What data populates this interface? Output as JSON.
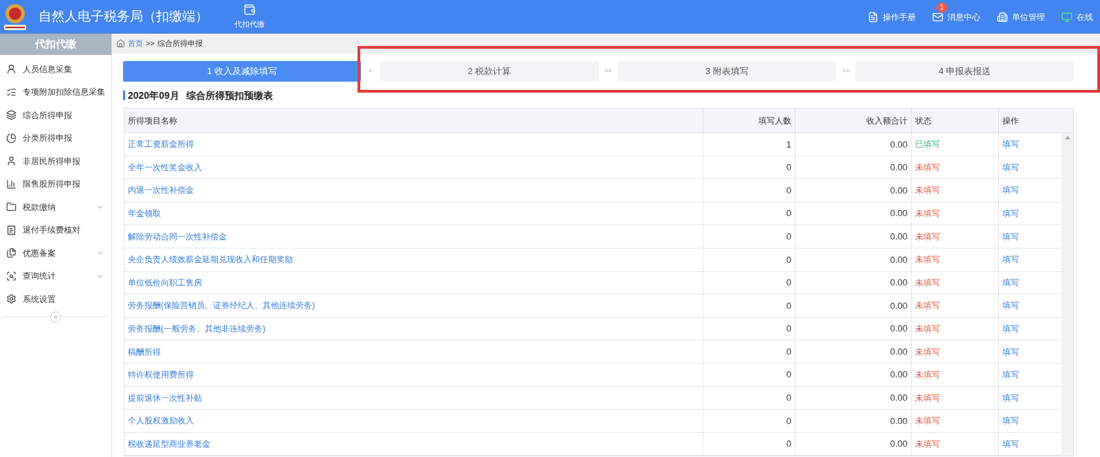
{
  "header": {
    "title": "自然人电子税务局（扣缴端）",
    "module": "代扣代缴",
    "links": [
      {
        "label": "操作手册"
      },
      {
        "label": "消息中心",
        "badge": "1"
      },
      {
        "label": "单位管理"
      },
      {
        "label": "在线"
      }
    ]
  },
  "sidebar": {
    "title": "代扣代缴",
    "items": [
      {
        "label": "人员信息采集",
        "expandable": false
      },
      {
        "label": "专项附加扣除信息采集",
        "expandable": false
      },
      {
        "label": "综合所得申报",
        "expandable": false
      },
      {
        "label": "分类所得申报",
        "expandable": false
      },
      {
        "label": "非居民所得申报",
        "expandable": false
      },
      {
        "label": "限售股所得申报",
        "expandable": false
      },
      {
        "label": "税款缴纳",
        "expandable": true
      },
      {
        "label": "退付手续费核对",
        "expandable": false
      },
      {
        "label": "优惠备案",
        "expandable": true
      },
      {
        "label": "查询统计",
        "expandable": true
      },
      {
        "label": "系统设置",
        "expandable": false
      }
    ],
    "collapse": "«"
  },
  "breadcrumb": {
    "home": "首页",
    "separator": ">>",
    "current": "综合所得申报"
  },
  "steps": [
    {
      "label": "1 收入及减除填写",
      "selected": true
    },
    {
      "separator": ">",
      "label": "2 税款计算",
      "selected": false
    },
    {
      "separator": ">>",
      "label": "3 附表填写",
      "selected": false
    },
    {
      "separator": ">>",
      "label": "4 申报表报送",
      "selected": false
    }
  ],
  "table_title": {
    "period": "2020年09月",
    "name": "综合所得预扣预缴表"
  },
  "table": {
    "columns": [
      "所得项目名称",
      "填写人数",
      "收入额合计",
      "状态",
      "操作"
    ],
    "rows": [
      {
        "name": "正常工资薪金所得",
        "count": "1",
        "amount": "0.00",
        "status": "已填写",
        "filled": true,
        "action": "填写"
      },
      {
        "name": "全年一次性奖金收入",
        "count": "0",
        "amount": "0.00",
        "status": "未填写",
        "filled": false,
        "action": "填写"
      },
      {
        "name": "内退一次性补偿金",
        "count": "0",
        "amount": "0.00",
        "status": "未填写",
        "filled": false,
        "action": "填写"
      },
      {
        "name": "年金领取",
        "count": "0",
        "amount": "0.00",
        "status": "未填写",
        "filled": false,
        "action": "填写"
      },
      {
        "name": "解除劳动合同一次性补偿金",
        "count": "0",
        "amount": "0.00",
        "status": "未填写",
        "filled": false,
        "action": "填写"
      },
      {
        "name": "央企负责人绩效薪金延期兑现收入和任期奖励",
        "count": "0",
        "amount": "0.00",
        "status": "未填写",
        "filled": false,
        "action": "填写"
      },
      {
        "name": "单位低价向职工售房",
        "count": "0",
        "amount": "0.00",
        "status": "未填写",
        "filled": false,
        "action": "填写"
      },
      {
        "name": "劳务报酬(保险营销员、证券经纪人、其他连续劳务)",
        "count": "0",
        "amount": "0.00",
        "status": "未填写",
        "filled": false,
        "action": "填写"
      },
      {
        "name": "劳务报酬(一般劳务、其他非连续劳务)",
        "count": "0",
        "amount": "0.00",
        "status": "未填写",
        "filled": false,
        "action": "填写"
      },
      {
        "name": "稿酬所得",
        "count": "0",
        "amount": "0.00",
        "status": "未填写",
        "filled": false,
        "action": "填写"
      },
      {
        "name": "特许权使用费所得",
        "count": "0",
        "amount": "0.00",
        "status": "未填写",
        "filled": false,
        "action": "填写"
      },
      {
        "name": "提前退休一次性补贴",
        "count": "0",
        "amount": "0.00",
        "status": "未填写",
        "filled": false,
        "action": "填写"
      },
      {
        "name": "个人股权激励收入",
        "count": "0",
        "amount": "0.00",
        "status": "未填写",
        "filled": false,
        "action": "填写"
      },
      {
        "name": "税收递延型商业养老金",
        "count": "0",
        "amount": "0.00",
        "status": "未填写",
        "filled": false,
        "action": "填写"
      }
    ]
  }
}
